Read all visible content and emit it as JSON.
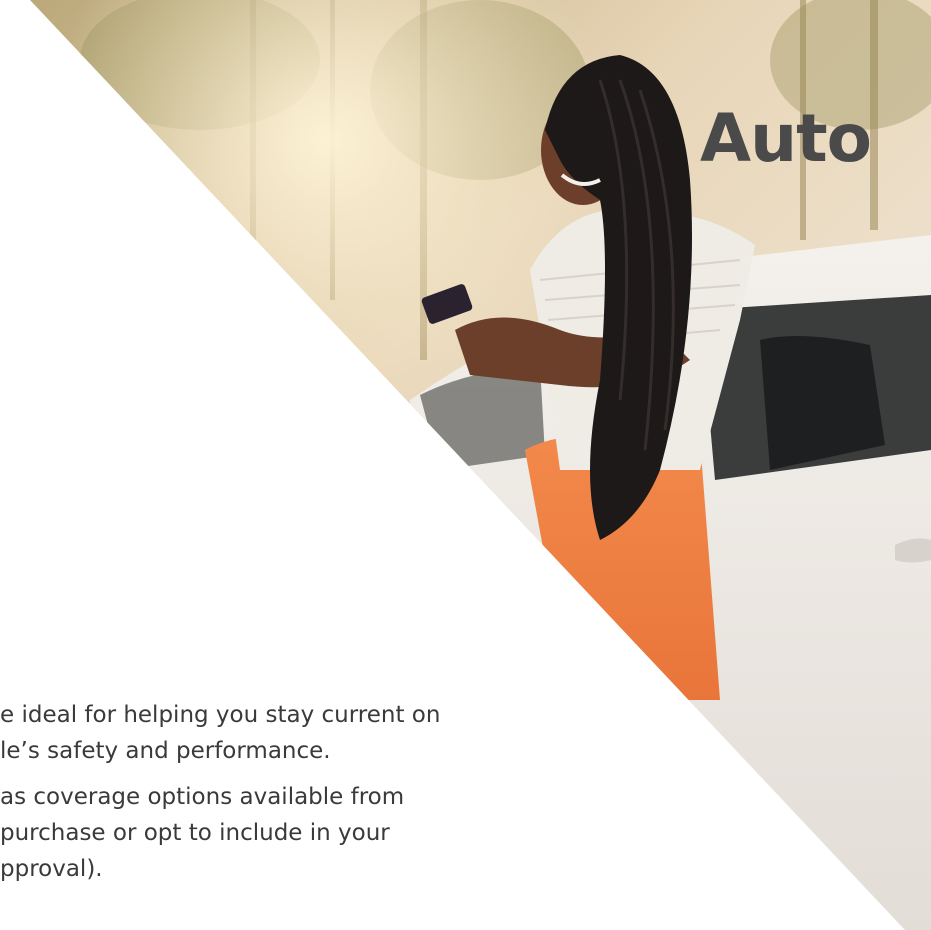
{
  "hero": {
    "headline": "Auto",
    "image_description": "woman-with-phone-leaning-on-white-car"
  },
  "content": {
    "paragraph_1_line_1": "e ideal for helping you stay current on",
    "paragraph_1_line_2": "le’s safety and performance.",
    "paragraph_2_line_1": "as coverage options available from",
    "paragraph_2_line_2": "purchase or opt to include in your",
    "paragraph_2_line_3": "pproval)."
  },
  "colors": {
    "headline": "#4a4a4a",
    "body_text": "#3a3a3a",
    "background": "#ffffff",
    "skirt_orange": "#f08a4b"
  }
}
